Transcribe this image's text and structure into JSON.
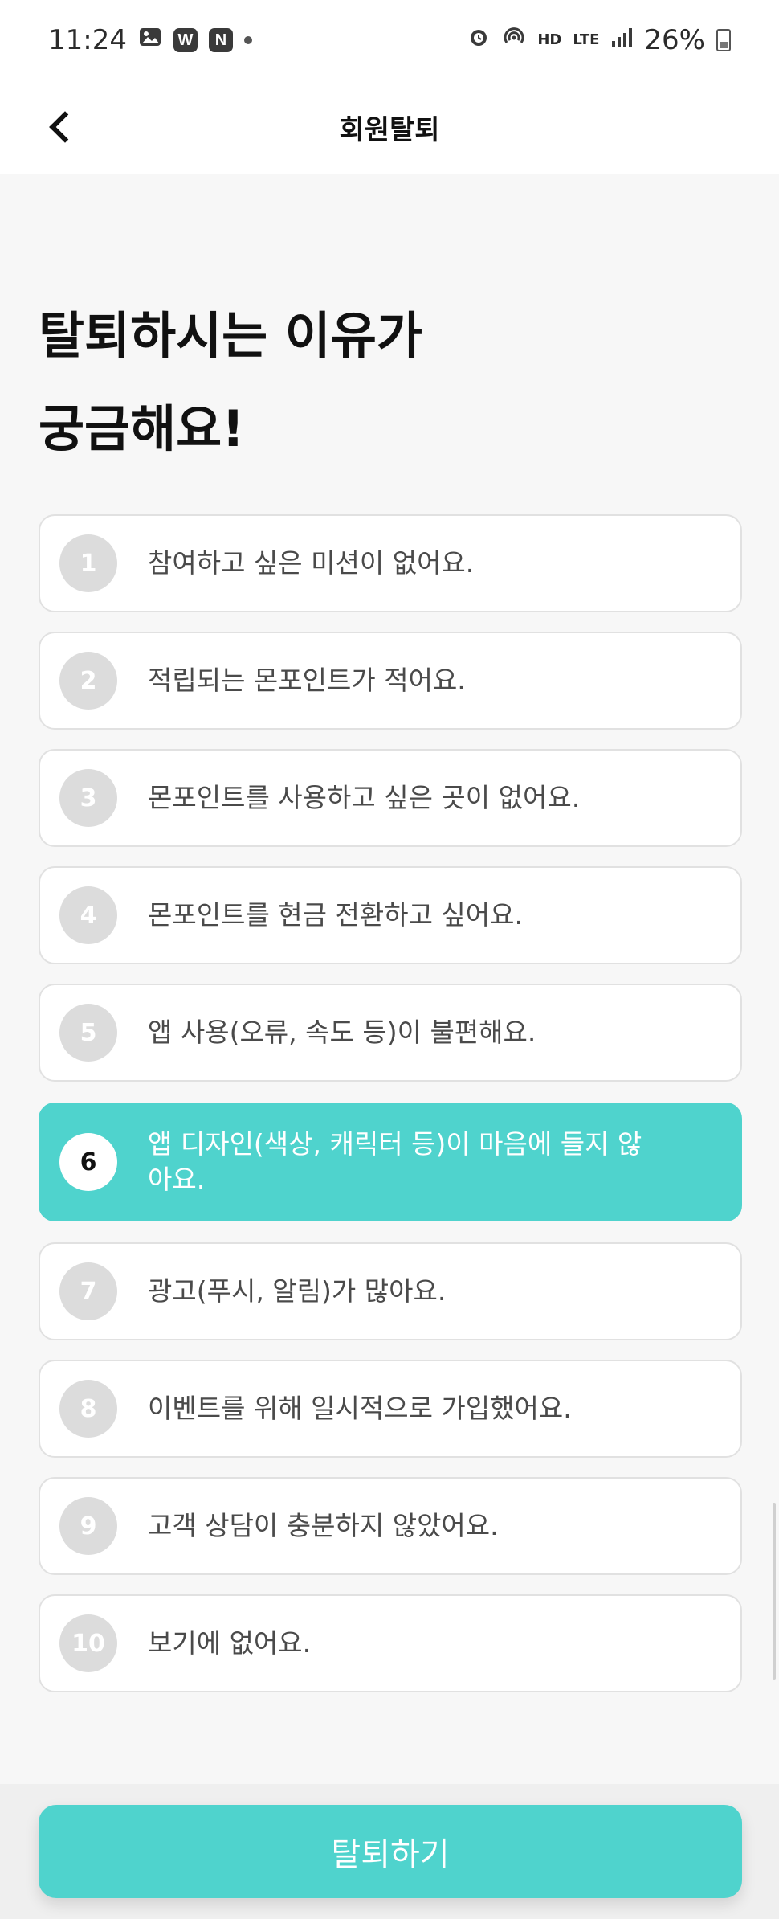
{
  "status_bar": {
    "time": "11:24",
    "icons_left": [
      "image-icon",
      "w-app-icon",
      "n-app-icon",
      "dot-icon"
    ],
    "w_icon_text": "W",
    "n_icon_text": "N",
    "hd_text": "HD",
    "lte_text": "LTE",
    "battery": "26%",
    "icons_right": [
      "alarm-icon",
      "hotspot-icon",
      "hd-voice-icon",
      "lte-icon",
      "signal-icon",
      "battery-icon"
    ]
  },
  "header": {
    "title": "회원탈퇴",
    "back_icon": "chevron-left-icon"
  },
  "headline": {
    "line1": "탈퇴하시는 이유가",
    "line2": "궁금해요!"
  },
  "options": [
    {
      "num": "1",
      "label": "참여하고 싶은 미션이 없어요."
    },
    {
      "num": "2",
      "label": "적립되는 몬포인트가 적어요."
    },
    {
      "num": "3",
      "label": "몬포인트를 사용하고 싶은 곳이 없어요."
    },
    {
      "num": "4",
      "label": "몬포인트를 현금 전환하고 싶어요."
    },
    {
      "num": "5",
      "label": "앱 사용(오류, 속도 등)이 불편해요."
    },
    {
      "num": "6",
      "label": "앱 디자인(색상, 캐릭터 등)이 마음에 들지 않아요."
    },
    {
      "num": "7",
      "label": "광고(푸시, 알림)가 많아요."
    },
    {
      "num": "8",
      "label": "이벤트를 위해 일시적으로 가입했어요."
    },
    {
      "num": "9",
      "label": "고객 상담이 충분하지 않았어요."
    },
    {
      "num": "10",
      "label": "보기에 없어요."
    }
  ],
  "selected_option": "6",
  "colors": {
    "accent": "#4fd3cd",
    "number_inactive": "#dcdcdc",
    "border": "#e1e1e1"
  },
  "withdraw_button": {
    "label": "탈퇴하기"
  }
}
